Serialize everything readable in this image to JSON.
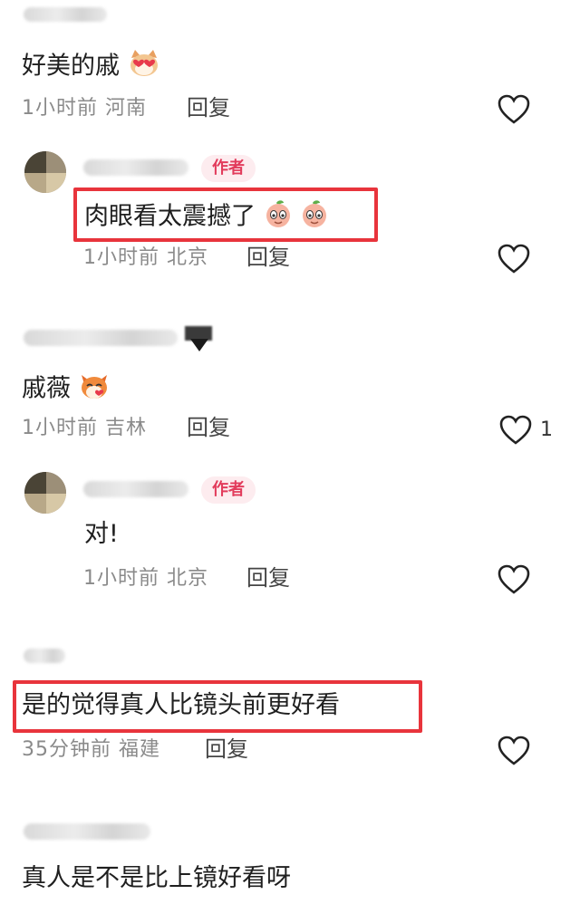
{
  "comments": [
    {
      "text": "好美的戚",
      "location": "1小时前 河南",
      "reply": "回复"
    },
    {
      "text": "肉眼看太震撼了",
      "location": "1小时前 北京",
      "reply": "回复",
      "badge": "作者"
    },
    {
      "text": "戚薇",
      "location": "1小时前 吉林",
      "reply": "回复",
      "likes": "1"
    },
    {
      "text": "对!",
      "location": "1小时前 北京",
      "reply": "回复",
      "badge": "作者"
    },
    {
      "text": "是的觉得真人比镜头前更好看",
      "location": "35分钟前 福建",
      "reply": "回复"
    },
    {
      "text": "真人是不是比上镜好看呀"
    }
  ],
  "colors": {
    "highlight": "#e8343c",
    "badge_bg": "#fdecef",
    "badge_text": "#e23c5c",
    "meta": "#8a8a8a"
  },
  "icons": [
    "heart-outline-icon",
    "cat-love-emoji",
    "peach-face-emoji",
    "fox-emoji"
  ]
}
